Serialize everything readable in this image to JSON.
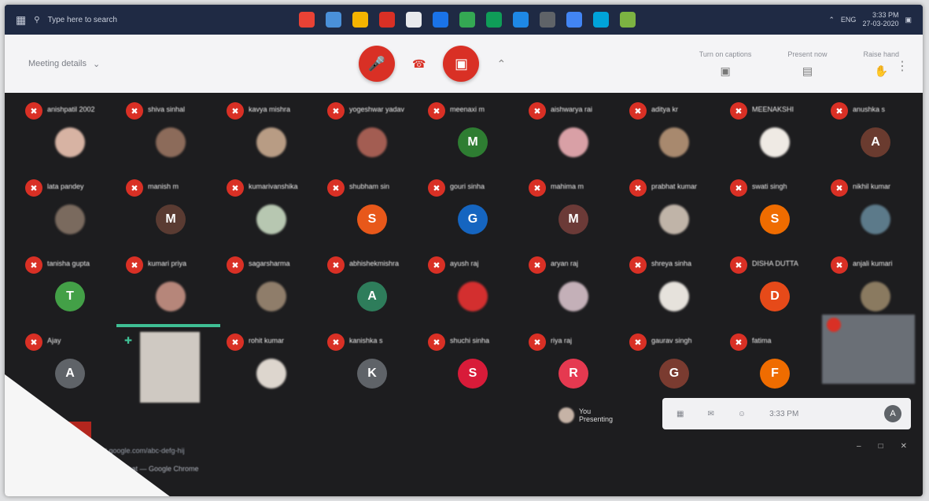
{
  "taskbar": {
    "search_text": "Type here to search",
    "apps": [
      "#e94235",
      "#4a90d9",
      "#f5b400",
      "#d93025",
      "#e8eaed",
      "#1a73e8",
      "#34a853",
      "#0f9d58",
      "#1e88e5",
      "#5f6368",
      "#4285f4",
      "#00a3d9",
      "#7cb342"
    ],
    "clock_time": "3:33 PM",
    "clock_date": "27-03-2020",
    "lang": "ENG"
  },
  "header": {
    "meeting_details": "Meeting details",
    "right_actions": [
      {
        "label": "Turn on captions",
        "icon": "caption-icon"
      },
      {
        "label": "Present now",
        "icon": "present-icon"
      },
      {
        "label": "Raise hand",
        "icon": "hand-icon"
      }
    ]
  },
  "colors": {
    "mic_red": "#d93025",
    "tile_bg": "#1d1d1f",
    "header_bg": "#f4f4f6"
  },
  "participants": [
    {
      "name": "anishpatil 2002",
      "avatar": "photo",
      "color": "#d7b3a3"
    },
    {
      "name": "shiva sinhal",
      "avatar": "photo",
      "color": "#8c6b5a"
    },
    {
      "name": "kavya mishra",
      "avatar": "photo",
      "color": "#b89c84"
    },
    {
      "name": "yogeshwar yadav",
      "avatar": "photo",
      "color": "#a35d52"
    },
    {
      "name": "meenaxi m",
      "avatar": "M",
      "color": "#2e7d32"
    },
    {
      "name": "aishwarya rai",
      "avatar": "photo",
      "color": "#d9a0a6"
    },
    {
      "name": "aditya kr",
      "avatar": "photo",
      "color": "#a8896e"
    },
    {
      "name": "MEENAKSHI",
      "avatar": "photo",
      "color": "#efeae4"
    },
    {
      "name": "anushka s",
      "avatar": "A",
      "color": "#6a3b2f"
    },
    {
      "name": "lata pandey",
      "avatar": "photo",
      "color": "#7a6a5e"
    },
    {
      "name": "manish m",
      "avatar": "M",
      "color": "#5a3b32"
    },
    {
      "name": "kumarivanshika",
      "avatar": "photo",
      "color": "#b7c7b1"
    },
    {
      "name": "shubham sin",
      "avatar": "S",
      "color": "#e8581a"
    },
    {
      "name": "gouri sinha",
      "avatar": "G",
      "color": "#1565c0"
    },
    {
      "name": "mahima m",
      "avatar": "M",
      "color": "#6b3a37"
    },
    {
      "name": "prabhat kumar",
      "avatar": "photo",
      "color": "#c0b4a8"
    },
    {
      "name": "swati singh",
      "avatar": "S",
      "color": "#ef6c00"
    },
    {
      "name": "nikhil kumar",
      "avatar": "photo",
      "color": "#5c7a8a"
    },
    {
      "name": "tanisha gupta",
      "avatar": "T",
      "color": "#43a047"
    },
    {
      "name": "kumari priya",
      "avatar": "photo",
      "color": "#b6867a"
    },
    {
      "name": "sagarsharma",
      "avatar": "photo",
      "color": "#8f7d6a"
    },
    {
      "name": "abhishekmishra",
      "avatar": "A",
      "color": "#2e7d5b"
    },
    {
      "name": "ayush raj",
      "avatar": "photo",
      "color": "#d32f2f"
    },
    {
      "name": "aryan raj",
      "avatar": "photo",
      "color": "#c4b0b8"
    },
    {
      "name": "shreya sinha",
      "avatar": "photo",
      "color": "#e6e2dc"
    },
    {
      "name": "DISHA DUTTA",
      "avatar": "D",
      "color": "#e64a19"
    },
    {
      "name": "anjali kumari",
      "avatar": "photo",
      "color": "#8a7a60"
    },
    {
      "name": "Ajay",
      "avatar": "A",
      "color": "#5f6368"
    },
    {
      "name": "rohit kumar",
      "avatar": "photo",
      "color": "#ddd6ce"
    },
    {
      "name": "kanishka s",
      "avatar": "K",
      "color": "#5f6368"
    },
    {
      "name": "shuchi sinha",
      "avatar": "S",
      "color": "#d81b39"
    },
    {
      "name": "riya raj",
      "avatar": "R",
      "color": "#e53950"
    },
    {
      "name": "gaurav singh",
      "avatar": "G",
      "color": "#7a3b30"
    },
    {
      "name": "fatima",
      "avatar": "F",
      "color": "#ef6c00"
    }
  ],
  "presenter_label": "Presenting",
  "you": {
    "name": "You",
    "status": "Presenting"
  },
  "panel": {
    "time": "3:33 PM",
    "avatar_letter": "A"
  },
  "caption_badge": "CC",
  "url_text": "meet.google.com/abc-defg-hij",
  "url_text2": "Chat — Google Chrome"
}
